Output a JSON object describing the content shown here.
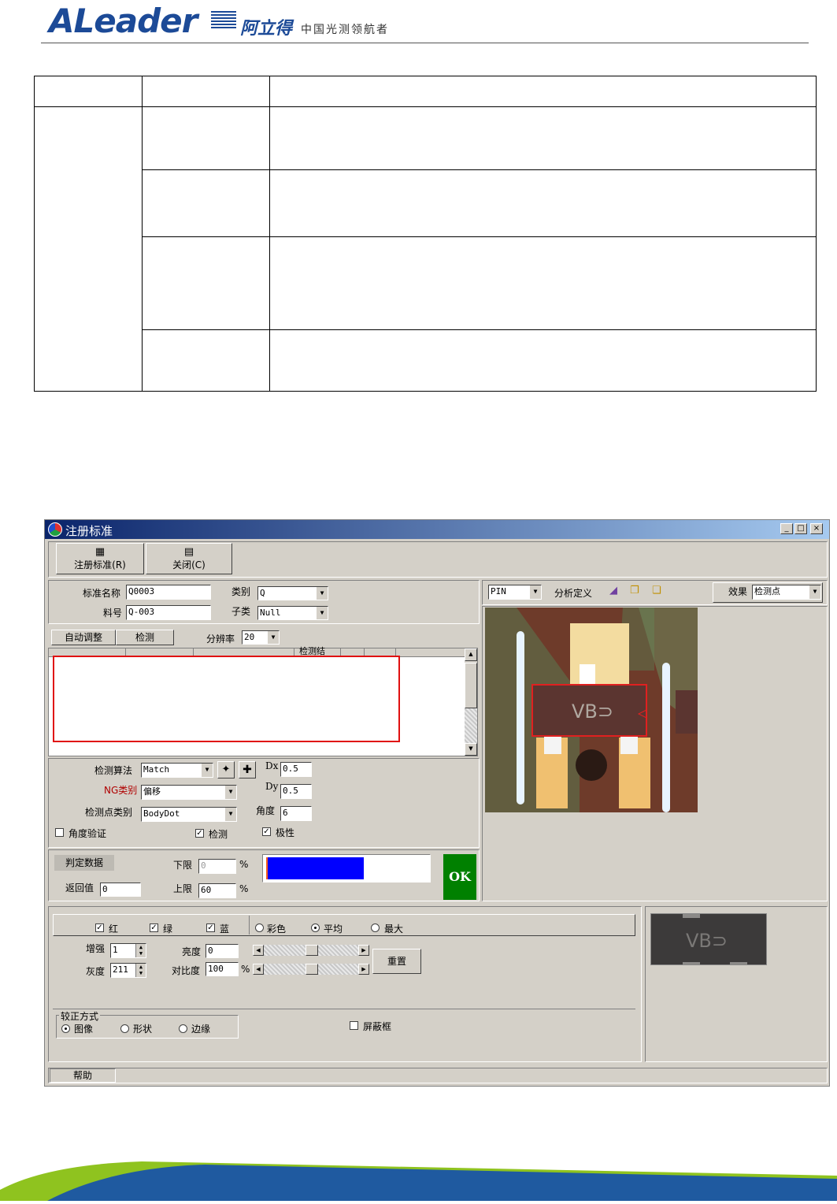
{
  "header": {
    "logo_word": "ALeader",
    "logo_cn": "阿立得",
    "slogan": "中国光测领航者"
  },
  "window": {
    "title": "注册标准",
    "caption_buttons": [
      "_",
      "□",
      "×"
    ],
    "toolbar": {
      "register_label": "注册标准(R)",
      "close_label": "关闭(C)"
    },
    "standard": {
      "name_label": "标准名称",
      "name_value": "Q0003",
      "part_label": "料号",
      "part_value": "Q-003",
      "category_label": "类别",
      "category_value": "Q",
      "subcategory_label": "子类",
      "subcategory_value": "Null"
    },
    "tabs": {
      "auto_adjust": "自动调整",
      "detect": "检测",
      "resolution_label": "分辨率",
      "resolution_value": "20"
    },
    "grid": {
      "partial_header": "检测结"
    },
    "detection": {
      "algorithm_label": "检测算法",
      "algorithm_value": "Match",
      "ng_type_label": "NG类别",
      "ng_type_value": "偏移",
      "point_type_label": "检测点类别",
      "point_type_value": "BodyDot",
      "dx_label": "Dx",
      "dx_value": "0.5",
      "dy_label": "Dy",
      "dy_value": "0.5",
      "angle_label": "角度",
      "angle_value": "6",
      "angle_verify_label": "角度验证",
      "detect_check_label": "检测",
      "polarity_label": "极性"
    },
    "judge": {
      "title": "判定数据",
      "lower_label": "下限",
      "lower_value": "0",
      "upper_label": "上限",
      "upper_value": "60",
      "return_label": "返回值",
      "return_value": "0",
      "percent": "%",
      "progress_fraction": 0.6,
      "result": "OK",
      "result_color": "#008000"
    },
    "view": {
      "pin_value": "PIN",
      "analysis_label": "分析定义",
      "effect_label": "效果",
      "effect_value": "检测点",
      "chip_text": "VB⊃"
    },
    "color": {
      "red_label": "红",
      "green_label": "绿",
      "blue_label": "蓝",
      "colorful_label": "彩色",
      "average_label": "平均",
      "max_label": "最大",
      "enhance_label": "增强",
      "enhance_value": "1",
      "gray_label": "灰度",
      "gray_value": "211",
      "brightness_label": "亮度",
      "brightness_value": "0",
      "contrast_label": "对比度",
      "contrast_value": "100",
      "percent": "%",
      "reset_label": "重置"
    },
    "correction": {
      "title": "较正方式",
      "image_label": "图像",
      "shape_label": "形状",
      "edge_label": "边缘",
      "mask_label": "屏蔽框"
    },
    "status": {
      "help_label": "帮助"
    }
  }
}
